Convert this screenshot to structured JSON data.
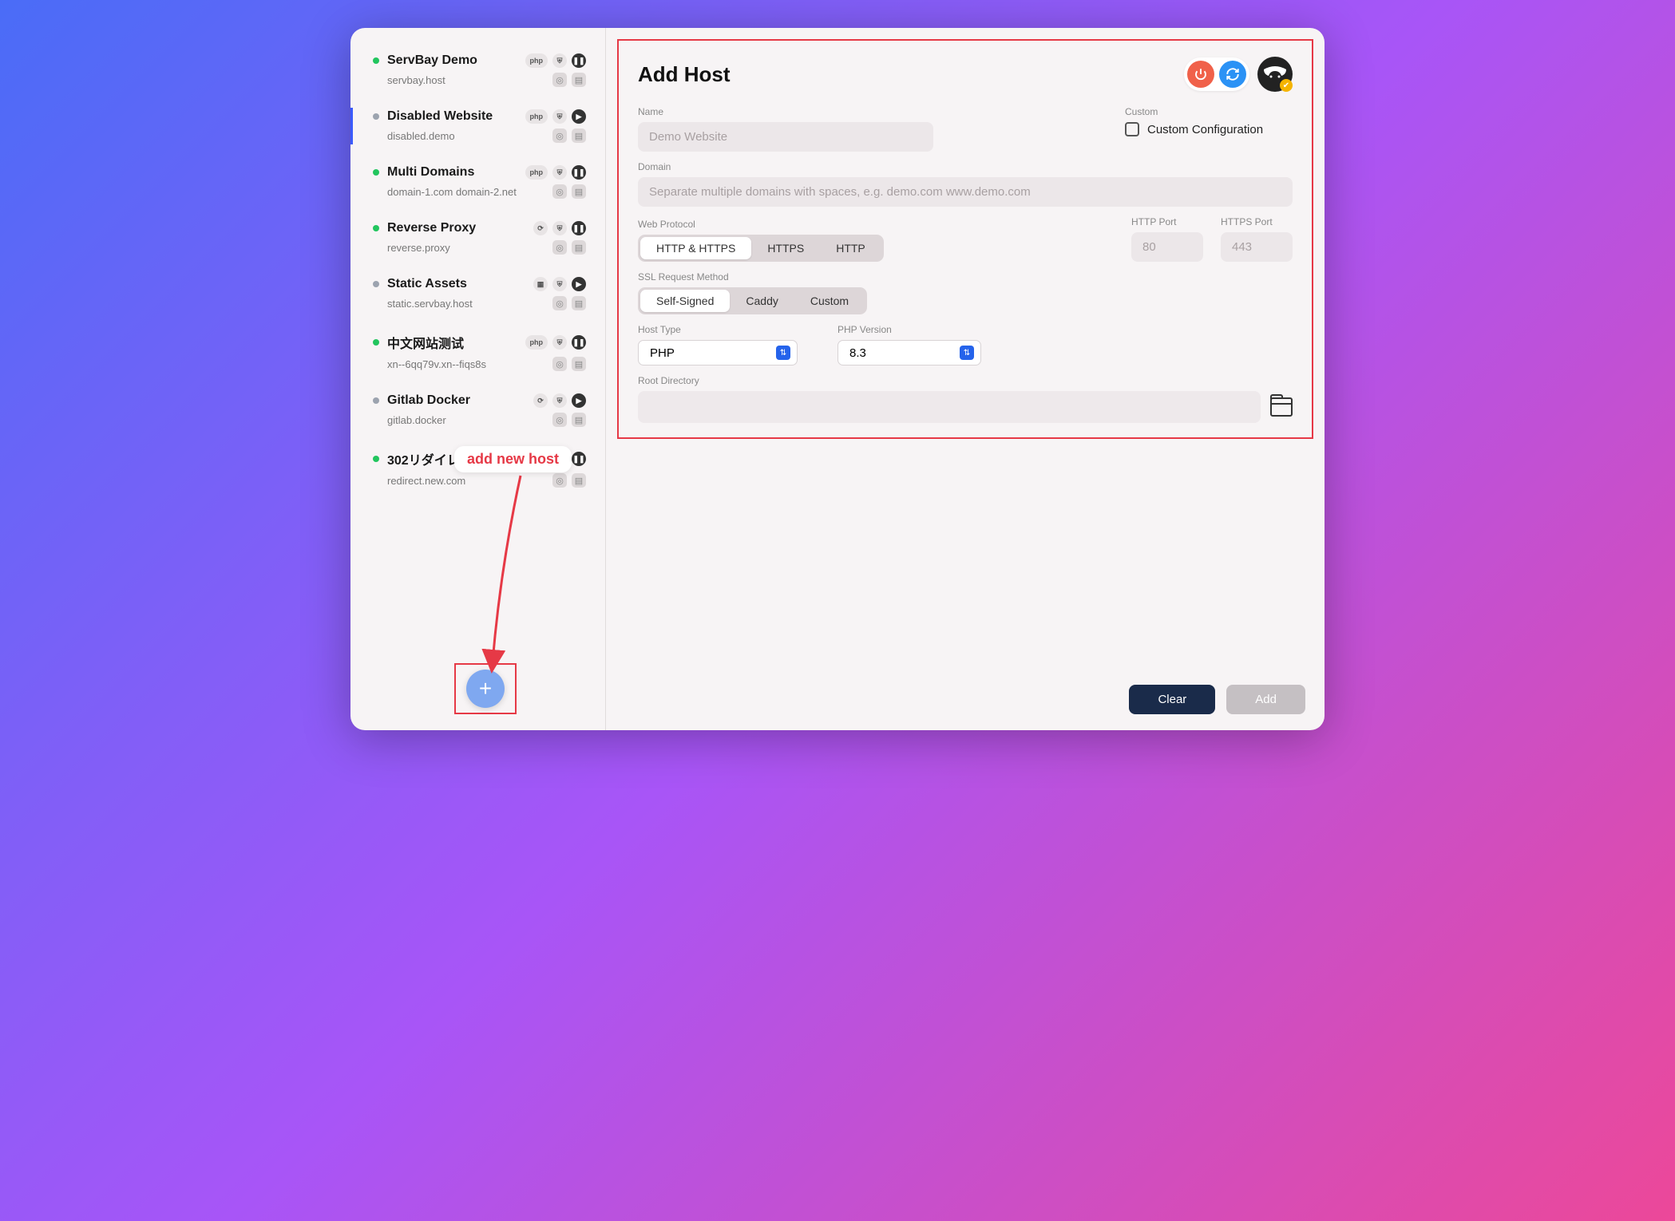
{
  "sidebar": {
    "hosts": [
      {
        "title": "ServBay Demo",
        "sub": "servbay.host",
        "status": "green",
        "tag": "php",
        "pause": true,
        "play": false,
        "selected": false
      },
      {
        "title": "Disabled Website",
        "sub": "disabled.demo",
        "status": "gray",
        "tag": "php",
        "pause": false,
        "play": true,
        "selected": true
      },
      {
        "title": "Multi Domains",
        "sub": "domain-1.com domain-2.net",
        "status": "green",
        "tag": "php",
        "pause": true,
        "play": false,
        "selected": false
      },
      {
        "title": "Reverse Proxy",
        "sub": "reverse.proxy",
        "status": "green",
        "tag": "alt",
        "pause": true,
        "play": false,
        "selected": false
      },
      {
        "title": "Static Assets",
        "sub": "static.servbay.host",
        "status": "gray",
        "tag": "static",
        "pause": false,
        "play": true,
        "selected": false
      },
      {
        "title": "中文网站测试",
        "sub": "xn--6qq79v.xn--fiqs8s",
        "status": "green",
        "tag": "php",
        "pause": true,
        "play": false,
        "selected": false
      },
      {
        "title": "Gitlab Docker",
        "sub": "gitlab.docker",
        "status": "gray",
        "tag": "alt",
        "pause": false,
        "play": true,
        "selected": false
      },
      {
        "title": "302リダイレクト",
        "sub": "redirect.new.com",
        "status": "green",
        "tag": "redirect",
        "pause": true,
        "play": false,
        "selected": false
      }
    ]
  },
  "callout": {
    "text": "add new host"
  },
  "header": {
    "title": "Add Host"
  },
  "form": {
    "name_label": "Name",
    "name_placeholder": "Demo Website",
    "custom_label": "Custom",
    "custom_checkbox_label": "Custom Configuration",
    "domain_label": "Domain",
    "domain_placeholder": "Separate multiple domains with spaces, e.g. demo.com www.demo.com",
    "web_protocol_label": "Web Protocol",
    "protocols": [
      "HTTP & HTTPS",
      "HTTPS",
      "HTTP"
    ],
    "http_port_label": "HTTP Port",
    "http_port_placeholder": "80",
    "https_port_label": "HTTPS Port",
    "https_port_placeholder": "443",
    "ssl_label": "SSL Request Method",
    "ssl_methods": [
      "Self-Signed",
      "Caddy",
      "Custom"
    ],
    "host_type_label": "Host Type",
    "host_type_value": "PHP",
    "php_version_label": "PHP Version",
    "php_version_value": "8.3",
    "root_dir_label": "Root Directory"
  },
  "footer": {
    "clear": "Clear",
    "add": "Add"
  }
}
